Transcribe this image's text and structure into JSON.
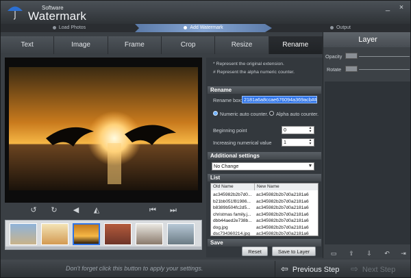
{
  "app": {
    "title_small": "Software",
    "title_big": "Watermark"
  },
  "window_controls": [
    "_",
    "×"
  ],
  "steps": [
    {
      "label": "Load Photos",
      "state": "done"
    },
    {
      "label": "Add Watermark",
      "state": "active"
    },
    {
      "label": "Output",
      "state": "pending"
    }
  ],
  "tabs": [
    "Text",
    "Image",
    "Frame",
    "Crop",
    "Resize",
    "Rename"
  ],
  "active_tab": "Rename",
  "panel": {
    "note1": "* Represent the original extension.",
    "note2": "# Represent the alpha numeric counter.",
    "rename_header": "Rename",
    "rename_box_label": "Rename box:",
    "rename_box_value": "2181a6a8ccae676094a369acb###",
    "radio_numeric": "Numeric auto counter.",
    "radio_alpha": "Alpha auto counter.",
    "beginning_label": "Beginning point",
    "beginning_value": "0",
    "increasing_label": "Increasing numerical value",
    "increasing_value": "1",
    "additional_header": "Additional settings",
    "dropdown_value": "No Change",
    "list_header": "List",
    "col_old": "Old Name",
    "col_new": "New Name",
    "rows": [
      {
        "old": "ac345982b2b7d0...",
        "new": "ac345982b2b7d0a2181a6"
      },
      {
        "old": "b21bb051f81986...",
        "new": "ac345982b2b7d0a2181a6"
      },
      {
        "old": "b8389b504fc2d5...",
        "new": "ac345982b2b7d0a2181a6"
      },
      {
        "old": "christmas family.j...",
        "new": "ac345982b2b7d0a2181a6"
      },
      {
        "old": "dbb44aed2e738b...",
        "new": "ac345982b2b7d0a2181a6"
      },
      {
        "old": "dog.jpg",
        "new": "ac345982b2b7d0a2181a6"
      },
      {
        "old": "dsc734360214.jpg",
        "new": "ac345982b2b7d0a2181a6"
      }
    ],
    "save_header": "Save",
    "reset_label": "Reset",
    "save_layer_label": "Save to Layer"
  },
  "layer": {
    "title": "Layer",
    "opacity_label": "Opacity",
    "rotate_label": "Rotate"
  },
  "footer": {
    "hint": "Don't forget click this button to apply your settings.",
    "prev_label": "Previous Step",
    "next_label": "Next Step"
  },
  "colors": {
    "accent": "#2f74e8",
    "sunset": "#f29a2e"
  }
}
